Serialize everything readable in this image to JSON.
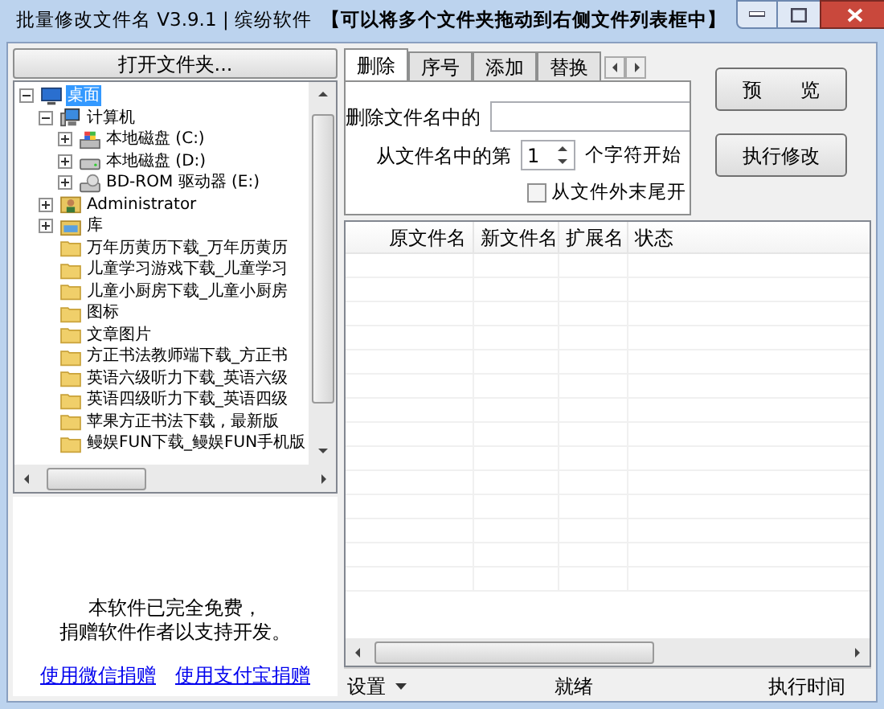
{
  "window": {
    "title": "批量修改文件名 V3.9.1 | 缤纷软件",
    "hint": "【可以将多个文件夹拖动到右侧文件列表框中】"
  },
  "left_panel": {
    "open_button": "打开文件夹...",
    "tree": [
      {
        "kind": "desktop",
        "label": "桌面",
        "selected": true,
        "expanded": true,
        "children": [
          {
            "kind": "computer",
            "label": "计算机",
            "selected": false,
            "expanded": true,
            "children": [
              {
                "kind": "system-drive",
                "label": "本地磁盘 (C:)",
                "selected": false,
                "expanded": false
              },
              {
                "kind": "drive",
                "label": "本地磁盘 (D:)",
                "selected": false,
                "expanded": false
              },
              {
                "kind": "optical-drive",
                "label": "BD-ROM 驱动器 (E:)",
                "selected": false,
                "expanded": false
              }
            ]
          },
          {
            "kind": "user",
            "label": "Administrator",
            "selected": false,
            "expanded": false
          },
          {
            "kind": "library",
            "label": "库",
            "selected": false,
            "expanded": false
          },
          {
            "kind": "folder",
            "label": "万年历黄历下载_万年历黄历",
            "selected": false
          },
          {
            "kind": "folder",
            "label": "儿童学习游戏下载_儿童学习",
            "selected": false
          },
          {
            "kind": "folder",
            "label": "儿童小厨房下载_儿童小厨房",
            "selected": false
          },
          {
            "kind": "folder",
            "label": "图标",
            "selected": false
          },
          {
            "kind": "folder",
            "label": "文章图片",
            "selected": false
          },
          {
            "kind": "folder",
            "label": "方正书法教师端下载_方正书",
            "selected": false
          },
          {
            "kind": "folder",
            "label": "英语六级听力下载_英语六级",
            "selected": false
          },
          {
            "kind": "folder",
            "label": "英语四级听力下载_英语四级",
            "selected": false
          },
          {
            "kind": "folder",
            "label": "苹果方正书法下载 , 最新版",
            "selected": false
          },
          {
            "kind": "folder",
            "label": "鳗娱FUN下载_鳗娱FUN手机版",
            "selected": false
          }
        ]
      }
    ],
    "notice": [
      "本软件已完全免费，",
      "捐赠软件作者以支持开发。"
    ],
    "links": [
      "使用微信捐赠",
      "使用支付宝捐赠"
    ]
  },
  "tabs": [
    {
      "label": "删除",
      "selected": true
    },
    {
      "label": "序号",
      "selected": false
    },
    {
      "label": "添加",
      "selected": false
    },
    {
      "label": "替换",
      "selected": false
    }
  ],
  "delete_form": {
    "name_label": "删除文件名中的",
    "start_label": "从文件名中的第",
    "start_value": "1",
    "start_suffix": "个字符开始",
    "from_end": {
      "label": "从文件外末尾开",
      "checked": false
    }
  },
  "actions": [
    "预　　览",
    "执行修改"
  ],
  "table": {
    "columns": [
      "原文件名",
      "新文件名",
      "扩展名",
      "状态"
    ]
  },
  "status_bar": {
    "settings": "设置",
    "state": "就绪",
    "time_label": "执行时间"
  }
}
